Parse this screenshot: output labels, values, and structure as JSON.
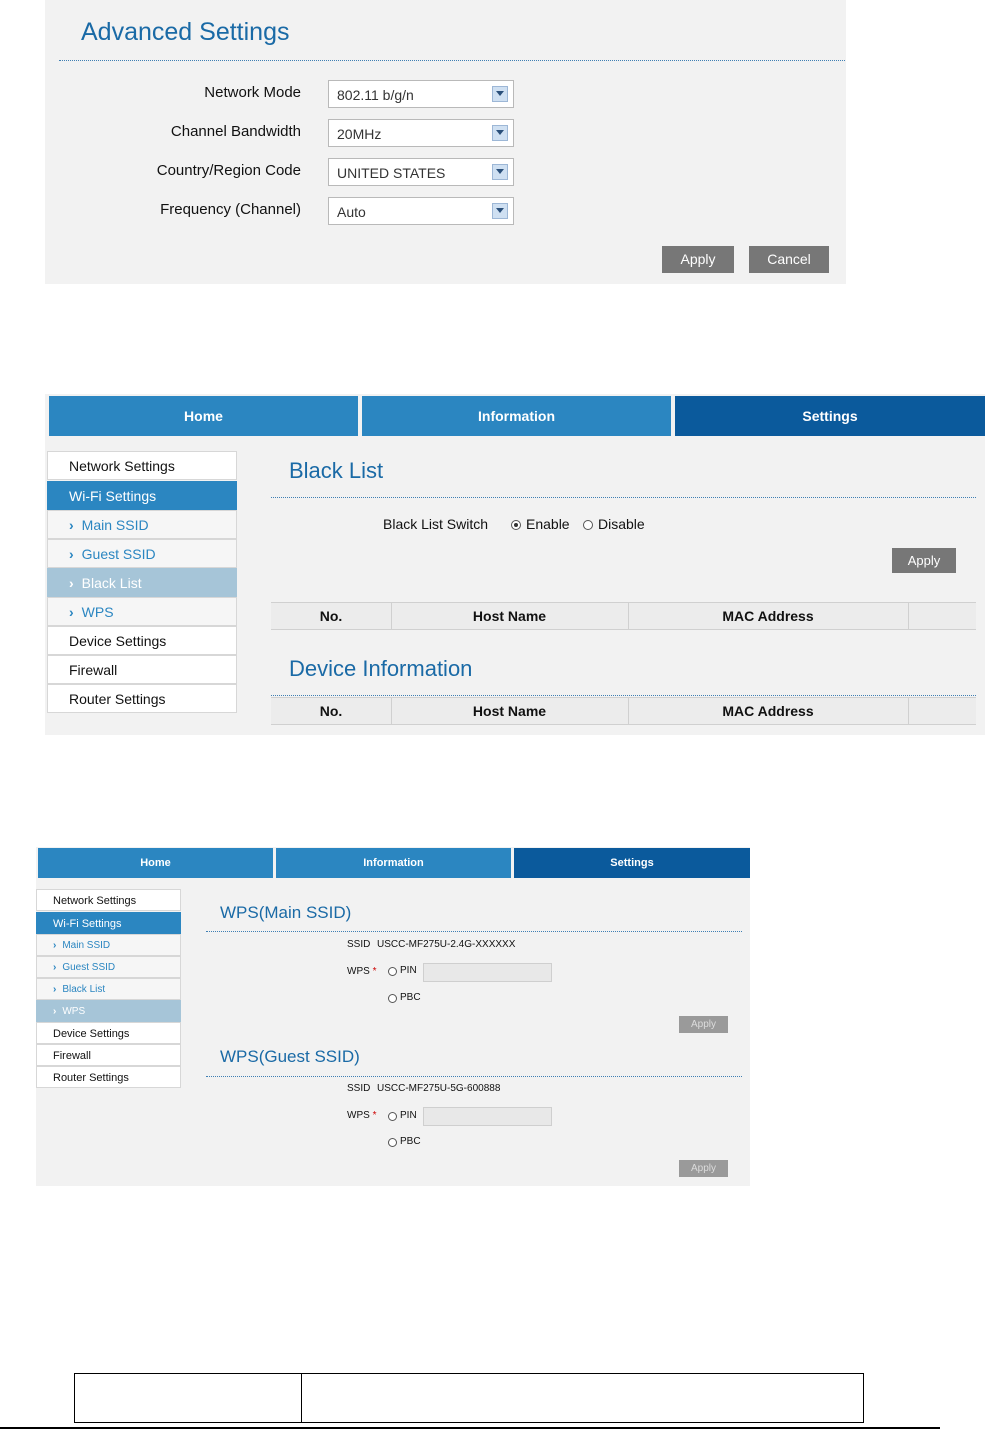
{
  "advanced": {
    "title": "Advanced Settings",
    "fields": [
      {
        "label": "Network Mode",
        "value": "802.11 b/g/n"
      },
      {
        "label": "Channel Bandwidth",
        "value": "20MHz"
      },
      {
        "label": "Country/Region Code",
        "value": "UNITED STATES"
      },
      {
        "label": "Frequency (Channel)",
        "value": "Auto"
      }
    ],
    "apply_label": "Apply",
    "cancel_label": "Cancel"
  },
  "nav": {
    "home": "Home",
    "information": "Information",
    "settings": "Settings"
  },
  "sidebar": {
    "network_settings": "Network Settings",
    "wifi_settings": "Wi-Fi Settings",
    "main_ssid": "Main SSID",
    "guest_ssid": "Guest SSID",
    "black_list": "Black List",
    "wps": "WPS",
    "device_settings": "Device Settings",
    "firewall": "Firewall",
    "router_settings": "Router Settings",
    "chevron": "›"
  },
  "blacklist": {
    "title": "Black List",
    "switch_label": "Black List Switch",
    "enable": "Enable",
    "disable": "Disable",
    "selected": "Enable",
    "apply_label": "Apply",
    "columns": [
      "No.",
      "Host Name",
      "MAC Address",
      ""
    ],
    "device_info_title": "Device Information",
    "device_columns": [
      "No.",
      "Host Name",
      "MAC Address",
      ""
    ]
  },
  "wps": {
    "main_title": "WPS(Main SSID)",
    "guest_title": "WPS(Guest SSID)",
    "ssid_label": "SSID",
    "main_ssid_value": "USCC-MF275U-2.4G-XXXXXX",
    "guest_ssid_value": "USCC-MF275U-5G-600888",
    "wps_label": "WPS",
    "required_mark": "*",
    "pin_label": "PIN",
    "pbc_label": "PBC",
    "apply_label": "Apply"
  }
}
